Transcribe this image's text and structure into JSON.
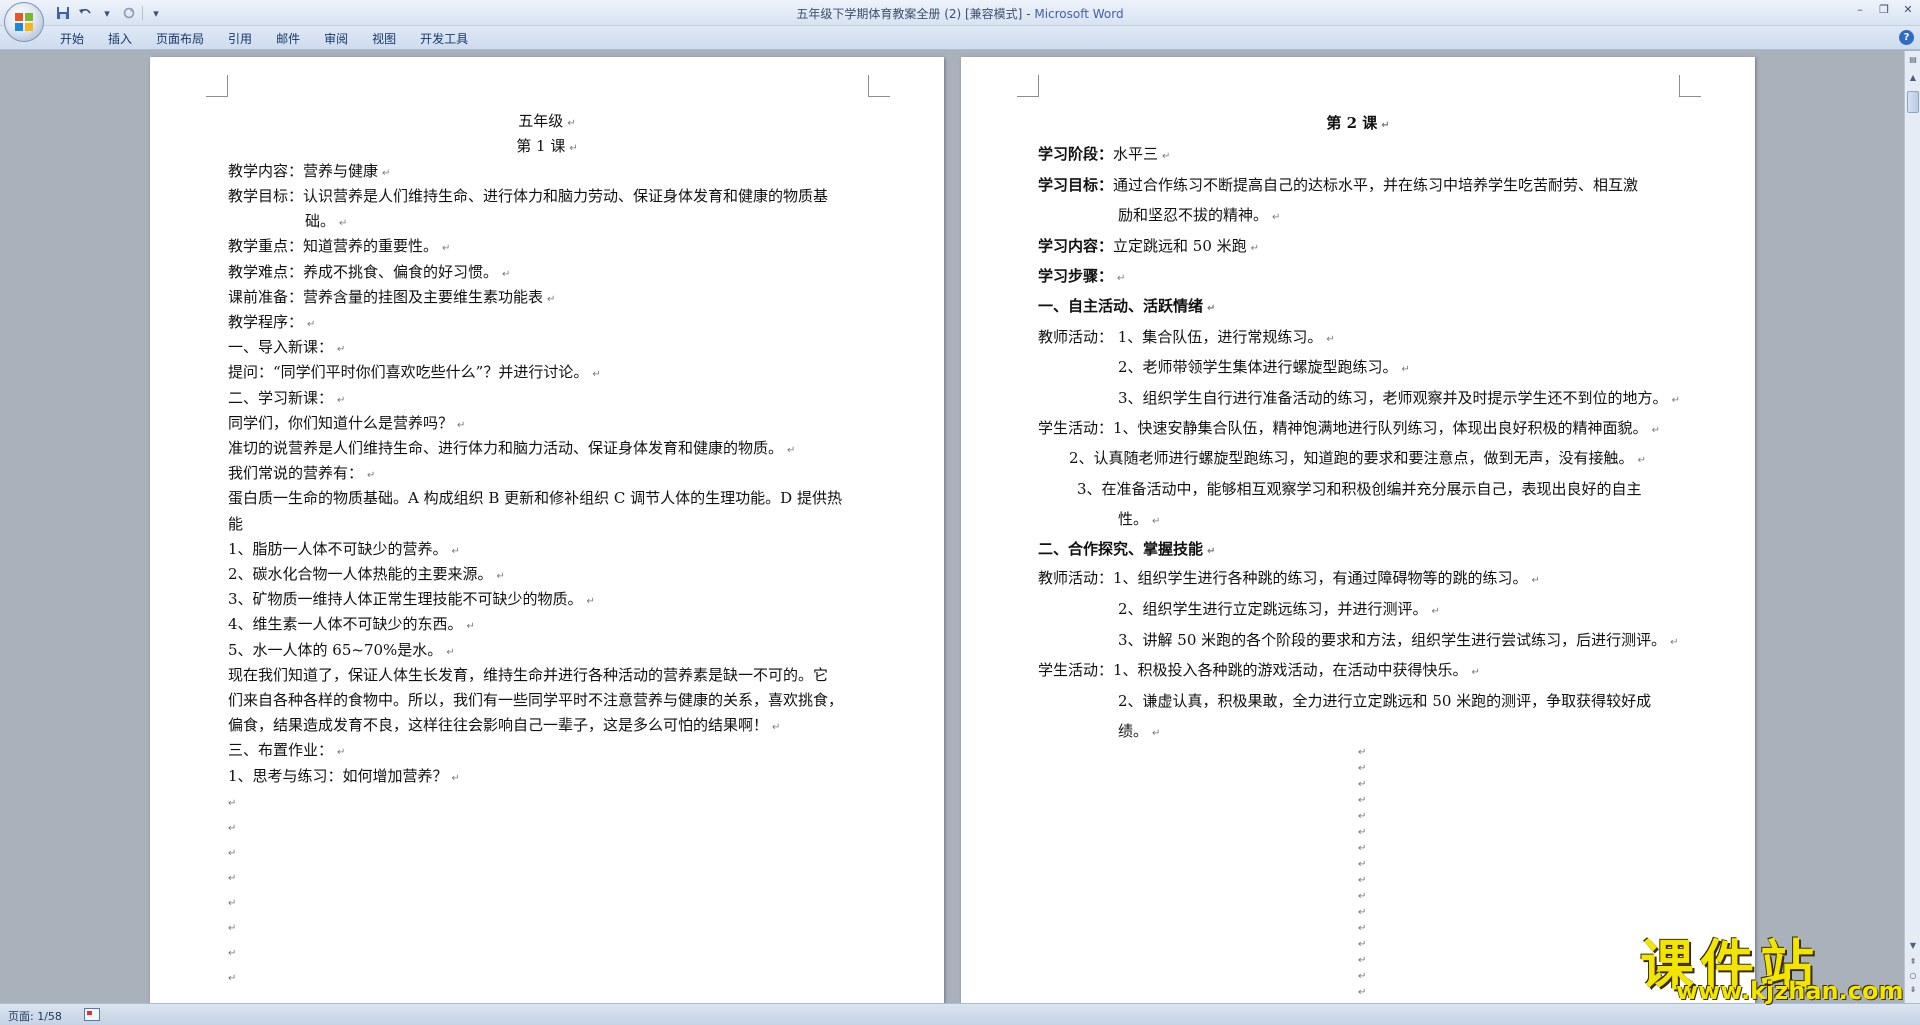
{
  "window": {
    "title": "五年级下学期体育教案全册 (2) [兼容模式]",
    "title_sep": " - ",
    "app_name": "Microsoft Word"
  },
  "ribbon": {
    "tabs": [
      "开始",
      "插入",
      "页面布局",
      "引用",
      "邮件",
      "审阅",
      "视图",
      "开发工具"
    ]
  },
  "paragraph_mark": "↵",
  "page1": {
    "title1": "五年级",
    "title2": "第 1 课",
    "lines": [
      "教学内容：营养与健康",
      "教学目标：认识营养是人们维持生命、进行体力和脑力劳动、保证身体发育和健康的物质基",
      "础。",
      "教学重点：知道营养的重要性。",
      "教学难点：养成不挑食、偏食的好习惯。",
      "课前准备：营养含量的挂图及主要维生素功能表",
      "教学程序：",
      "一、导入新课：",
      "提问：“同学们平时你们喜欢吃些什么”？并进行讨论。",
      "二、学习新课：",
      "同学们，你们知道什么是营养吗？",
      "准切的说营养是人们维持生命、进行体力和脑力活动、保证身体发育和健康的物质。",
      "我们常说的营养有：",
      "蛋白质一生命的物质基础。A 构成组织 B 更新和修补组织 C 调节人体的生理功能。D 提供热",
      "能",
      "1、脂肪一人体不可缺少的营养。",
      "2、碳水化合物一人体热能的主要来源。",
      "3、矿物质一维持人体正常生理技能不可缺少的物质。",
      "4、维生素一人体不可缺少的东西。",
      "5、水一人体的 65~70%是水。",
      "现在我们知道了，保证人体生长发育，维持生命并进行各种活动的营养素是缺一不可的。它",
      "们来自各种各样的食物中。所以，我们有一些同学平时不注意营养与健康的关系，喜欢挑食，",
      "偏食，结果造成发育不良，这样往往会影响自己一辈子，这是多么可怕的结果啊！",
      "三、布置作业：",
      "1、思考与练习：如何增加营养？"
    ]
  },
  "page2": {
    "title": "第 2 课",
    "lines": [
      {
        "label": "学习阶段：",
        "text": "水平三"
      },
      {
        "label": "学习目标：",
        "text": "通过合作练习不断提高自己的达标水平，并在练习中培养学生吃苦耐劳、相互激"
      },
      {
        "label": "",
        "text": "励和坚忍不拔的精神。"
      },
      {
        "label": "学习内容：",
        "text": "立定跳远和 50 米跑"
      },
      {
        "label": "学习步骤：",
        "text": ""
      },
      {
        "label": "一、自主活动、活跃情绪",
        "text": ""
      },
      {
        "label": "",
        "text": "教师活动：  1、集合队伍，进行常规练习。"
      },
      {
        "label": "",
        "text": "2、老师带领学生集体进行螺旋型跑练习。"
      },
      {
        "label": "",
        "text": "3、组织学生自行进行准备活动的练习，老师观察并及时提示学生还不到位的地方。"
      },
      {
        "label": "",
        "text": "学生活动：1、快速安静集合队伍，精神饱满地进行队列练习，体现出良好积极的精神面貌。"
      },
      {
        "label": "",
        "text": "2、认真随老师进行螺旋型跑练习，知道跑的要求和要注意点，做到无声，没有接触。"
      },
      {
        "label": "",
        "text": "3、在准备活动中，能够相互观察学习和积极创编并充分展示自己，表现出良好的自主"
      },
      {
        "label": "",
        "text": "性。"
      },
      {
        "label": "二、合作探究、掌握技能",
        "text": ""
      },
      {
        "label": "",
        "text": "教师活动：1、组织学生进行各种跳的练习，有通过障碍物等的跳的练习。"
      },
      {
        "label": "",
        "text": "2、组织学生进行立定跳远练习，并进行测评。"
      },
      {
        "label": "",
        "text": "3、讲解 50 米跑的各个阶段的要求和方法，组织学生进行尝试练习，后进行测评。"
      },
      {
        "label": "",
        "text": "学生活动：1、积极投入各种跳的游戏活动，在活动中获得快乐。"
      },
      {
        "label": "",
        "text": "2、谦虚认真，积极果敢，全力进行立定跳远和 50 米跑的测评，争取获得较好成"
      },
      {
        "label": "",
        "text": "绩。"
      }
    ]
  },
  "status": {
    "page_indicator": "页面: 1/58"
  },
  "watermark": {
    "title": "课件站",
    "url": "www.kjzhan.com"
  },
  "icons": {
    "office_button": "office-logo-icon",
    "save": "save-icon",
    "undo": "undo-icon",
    "redo": "redo-icon",
    "help": "help-icon"
  },
  "colors": {
    "app_name": "#4060a8",
    "watermark": "#f2e600",
    "workspace": "#a9b1bb"
  }
}
